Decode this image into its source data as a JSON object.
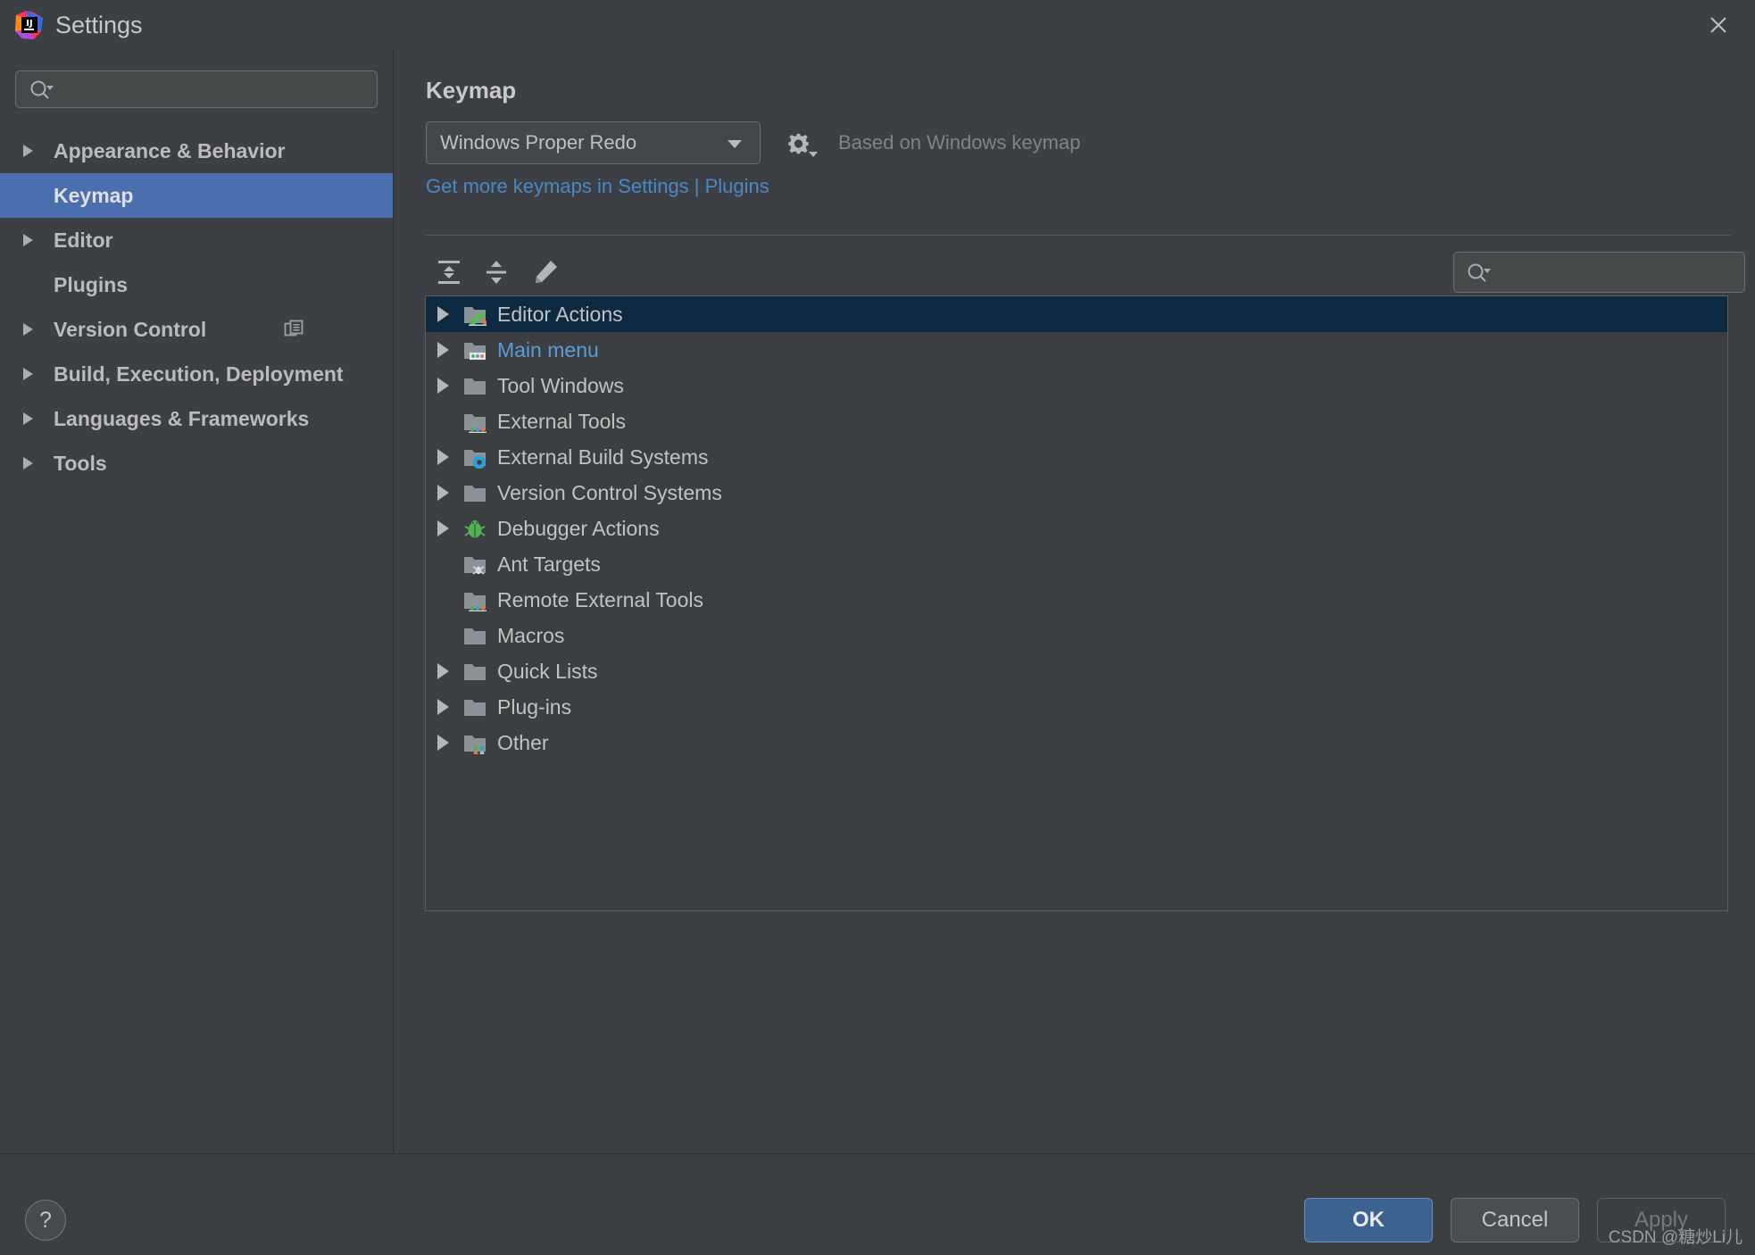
{
  "window": {
    "title": "Settings",
    "app_icon": "intellij-idea-logo",
    "close_icon": "close-icon"
  },
  "sidebar": {
    "search": {
      "placeholder": "",
      "value": "",
      "icon": "search-icon"
    },
    "items": [
      {
        "label": "Appearance & Behavior",
        "expandable": true,
        "selected": false,
        "trailing_icon": ""
      },
      {
        "label": "Keymap",
        "expandable": false,
        "selected": true,
        "trailing_icon": ""
      },
      {
        "label": "Editor",
        "expandable": true,
        "selected": false,
        "trailing_icon": ""
      },
      {
        "label": "Plugins",
        "expandable": false,
        "selected": false,
        "trailing_icon": ""
      },
      {
        "label": "Version Control",
        "expandable": true,
        "selected": false,
        "trailing_icon": "copy-icon"
      },
      {
        "label": "Build, Execution, Deployment",
        "expandable": true,
        "selected": false,
        "trailing_icon": ""
      },
      {
        "label": "Languages & Frameworks",
        "expandable": true,
        "selected": false,
        "trailing_icon": ""
      },
      {
        "label": "Tools",
        "expandable": true,
        "selected": false,
        "trailing_icon": ""
      }
    ]
  },
  "main": {
    "page_title": "Keymap",
    "keymap_select": {
      "value": "Windows Proper Redo",
      "icon": "chevron-down-icon"
    },
    "gear_icon": "gear-dropdown-icon",
    "based_on": "Based on Windows keymap",
    "plugins_link": "Get more keymaps in Settings | Plugins",
    "toolbar": {
      "expand_all": "expand-all-icon",
      "collapse_all": "collapse-all-icon",
      "edit": "edit-pencil-icon",
      "find_shortcut": "find-by-shortcut-icon",
      "search": {
        "placeholder": "",
        "value": "",
        "icon": "search-icon"
      }
    },
    "tree": [
      {
        "label": "Editor Actions",
        "icon": "folder-edit-icon",
        "expandable": true,
        "selected": true,
        "match": false
      },
      {
        "label": "Main menu",
        "icon": "folder-menu-icon",
        "expandable": true,
        "selected": false,
        "match": true
      },
      {
        "label": "Tool Windows",
        "icon": "folder-icon",
        "expandable": true,
        "selected": false,
        "match": false
      },
      {
        "label": "External Tools",
        "icon": "folder-tools-icon",
        "expandable": false,
        "selected": false,
        "match": false
      },
      {
        "label": "External Build Systems",
        "icon": "folder-gear-icon",
        "expandable": true,
        "selected": false,
        "match": false
      },
      {
        "label": "Version Control Systems",
        "icon": "folder-icon",
        "expandable": true,
        "selected": false,
        "match": false
      },
      {
        "label": "Debugger Actions",
        "icon": "bug-icon",
        "expandable": true,
        "selected": false,
        "match": false
      },
      {
        "label": "Ant Targets",
        "icon": "folder-ant-icon",
        "expandable": false,
        "selected": false,
        "match": false
      },
      {
        "label": "Remote External Tools",
        "icon": "folder-tools-icon",
        "expandable": false,
        "selected": false,
        "match": false
      },
      {
        "label": "Macros",
        "icon": "folder-icon",
        "expandable": false,
        "selected": false,
        "match": false
      },
      {
        "label": "Quick Lists",
        "icon": "folder-icon",
        "expandable": true,
        "selected": false,
        "match": false
      },
      {
        "label": "Plug-ins",
        "icon": "folder-icon",
        "expandable": true,
        "selected": false,
        "match": false
      },
      {
        "label": "Other",
        "icon": "folder-dots-icon",
        "expandable": true,
        "selected": false,
        "match": false
      }
    ]
  },
  "footer": {
    "help_label": "?",
    "ok_label": "OK",
    "cancel_label": "Cancel",
    "apply_label": "Apply",
    "apply_enabled": false,
    "watermark": "CSDN @糖炒Li儿"
  },
  "colors": {
    "window_bg": "#3c4044",
    "panel_bg": "#3c3f41",
    "accent_blue": "#4b6eaf",
    "link_blue": "#4a88c7",
    "tree_selected": "#0d2a42",
    "match_blue": "#5a9bd8",
    "ok_button": "#3c628f",
    "text": "#bbbbbb",
    "muted_text": "#7f8487"
  }
}
